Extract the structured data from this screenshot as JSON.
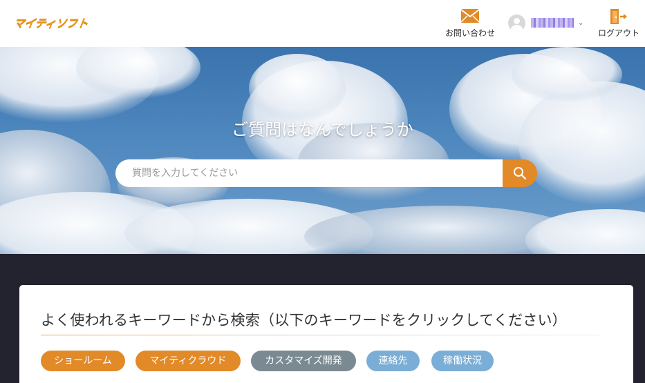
{
  "header": {
    "logo": "マイティソフト",
    "contact_label": "お問い合わせ",
    "user_name": "■■■■■",
    "logout_label": "ログアウト"
  },
  "hero": {
    "title": "ご質問はなんでしょうか",
    "search_placeholder": "質問を入力してください",
    "search_value": ""
  },
  "keywords": {
    "title": "よく使われるキーワードから検索（以下のキーワードをクリックしてください）",
    "tags": [
      {
        "label": "ショールーム",
        "color": "#e28a28"
      },
      {
        "label": "マイティクラウド",
        "color": "#e28a28"
      },
      {
        "label": "カスタマイズ開発",
        "color": "#7b8a92"
      },
      {
        "label": "連絡先",
        "color": "#7aaed6"
      },
      {
        "label": "稼働状況",
        "color": "#7aaed6"
      }
    ]
  },
  "colors": {
    "accent": "#e28a28",
    "logo": "#ee9a1c",
    "page_background": "#22232f"
  },
  "icons": {
    "contact": "mail-icon",
    "user": "avatar-icon",
    "logout": "logout-door-icon",
    "search": "search-icon"
  }
}
